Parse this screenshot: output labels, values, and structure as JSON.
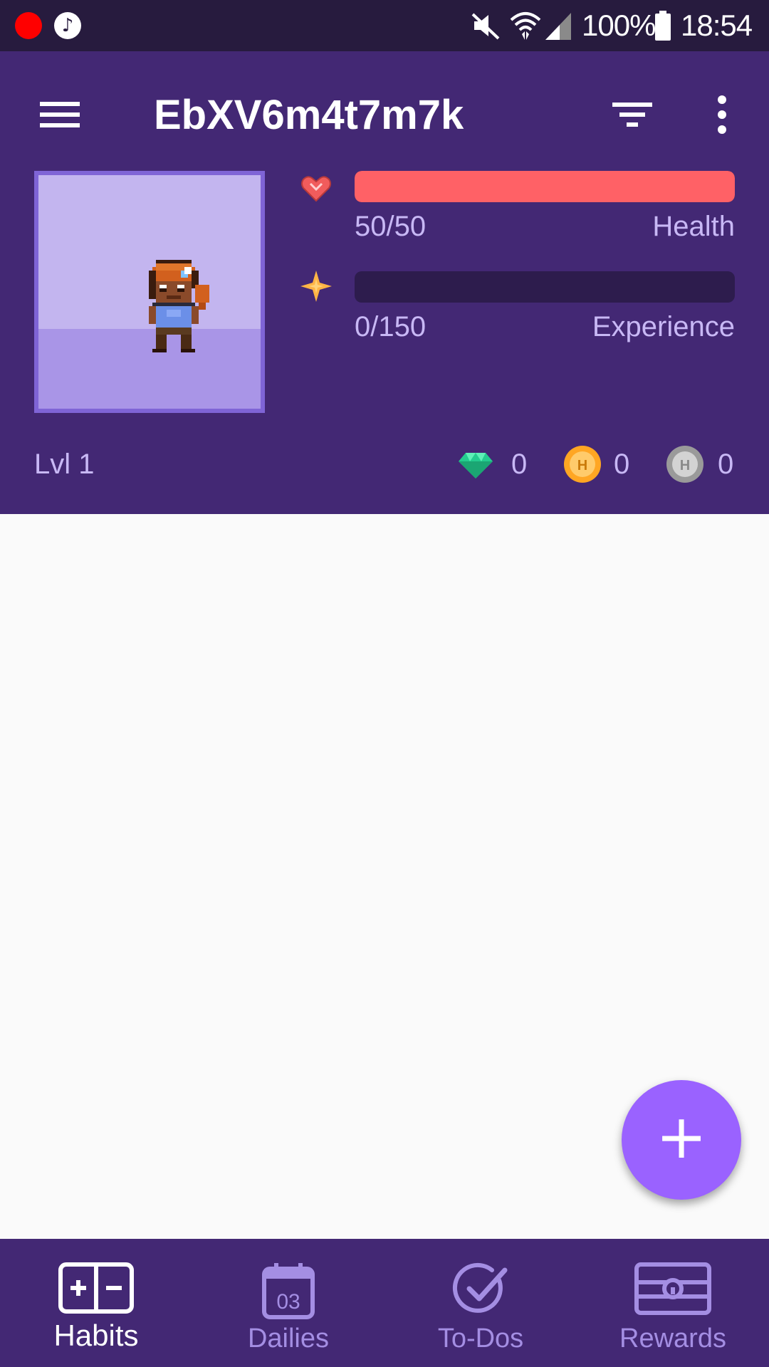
{
  "status_bar": {
    "battery_percent": "100%",
    "time": "18:54",
    "icons": [
      "record-icon",
      "music-icon",
      "mute-icon",
      "wifi-icon",
      "signal-icon",
      "battery-icon"
    ]
  },
  "toolbar": {
    "title": "EbXV6m4t7m7k",
    "icons": [
      "menu-icon",
      "filter-icon",
      "more-vert-icon"
    ]
  },
  "stats": {
    "health": {
      "value_text": "50/50",
      "label": "Health",
      "fill_fraction": 1.0,
      "color": "#ff6166",
      "icon": "heart-icon"
    },
    "experience": {
      "value_text": "0/150",
      "label": "Experience",
      "fill_fraction": 0.0,
      "color": "#ffb445",
      "icon": "star-icon"
    }
  },
  "profile": {
    "level": "Lvl 1",
    "gems": "0",
    "gold": "0",
    "hourglasses": "0"
  },
  "fab": {
    "label": "+",
    "color": "#9a62ff"
  },
  "bottom_nav": {
    "active": "Habits",
    "items": [
      {
        "label": "Habits",
        "icon": "habits-icon"
      },
      {
        "label": "Dailies",
        "icon": "calendar-icon",
        "icon_text": "03"
      },
      {
        "label": "To-Dos",
        "icon": "check-circle-icon"
      },
      {
        "label": "Rewards",
        "icon": "treasure-chest-icon"
      }
    ]
  },
  "colors": {
    "primary": "#432874",
    "status_bar": "#271b3e",
    "bar_track": "#2d1c4d",
    "text_muted": "#c8b8f5",
    "nav_inactive": "#a48ee3"
  }
}
